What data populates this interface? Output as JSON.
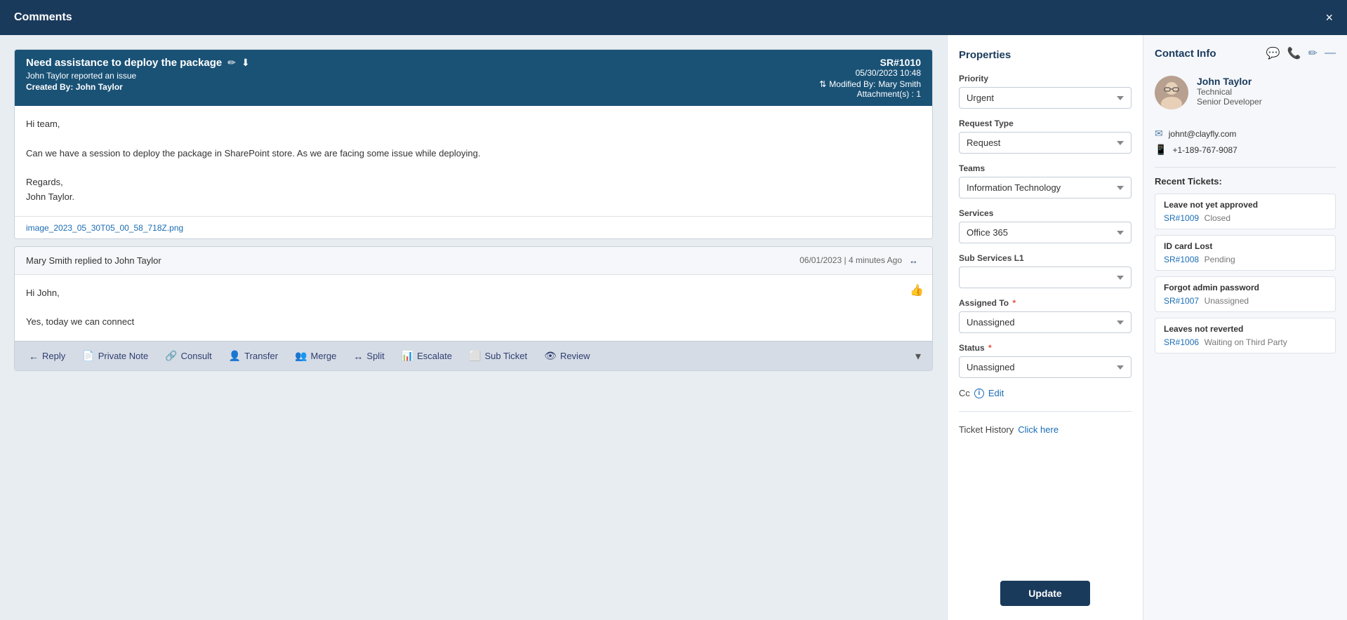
{
  "modal": {
    "title": "Comments",
    "close_label": "×"
  },
  "ticket": {
    "title": "Need assistance to deploy the package",
    "sr_number": "SR#1010",
    "reported": "John Taylor reported an issue",
    "created_by_label": "Created By:",
    "created_by": "John Taylor",
    "date": "05/30/2023 10:48",
    "modified_by_label": "Modified By:",
    "modified_by": "Mary Smith",
    "attachments_label": "Attachment(s) :",
    "attachments_count": "1",
    "body_line1": "Hi team,",
    "body_line2": "Can we have a session to deploy the package in SharePoint store. As we are facing some issue while deploying.",
    "body_line3": "Regards,",
    "body_line4": "John Taylor.",
    "attachment_link": "image_2023_05_30T05_00_58_718Z.png"
  },
  "reply": {
    "author": "Mary Smith replied to John Taylor",
    "date": "06/01/2023 | 4 minutes Ago",
    "expand_icon": "↔",
    "body_line1": "Hi John,",
    "body_line2": "Yes, today we can connect"
  },
  "actions": {
    "reply_label": "Reply",
    "private_note_label": "Private Note",
    "consult_label": "Consult",
    "transfer_label": "Transfer",
    "merge_label": "Merge",
    "split_label": "Split",
    "escalate_label": "Escalate",
    "sub_ticket_label": "Sub Ticket",
    "review_label": "Review"
  },
  "properties": {
    "title": "Properties",
    "priority_label": "Priority",
    "priority_value": "Urgent",
    "request_type_label": "Request Type",
    "request_type_value": "Request",
    "teams_label": "Teams",
    "teams_value": "Information Technology",
    "services_label": "Services",
    "services_value": "Office 365",
    "sub_services_label": "Sub Services L1",
    "sub_services_value": "",
    "assigned_to_label": "Assigned To",
    "assigned_to_value": "Unassigned",
    "status_label": "Status",
    "status_value": "Unassigned",
    "cc_label": "Cc",
    "cc_edit": "Edit",
    "ticket_history_label": "Ticket History",
    "ticket_history_link": "Click here",
    "update_btn": "Update"
  },
  "contact": {
    "title": "Contact Info",
    "name": "John Taylor",
    "role": "Technical",
    "job_title": "Senior Developer",
    "email": "johnt@clayfly.com",
    "phone": "+1-189-767-9087",
    "recent_tickets_title": "Recent Tickets:",
    "tickets": [
      {
        "title": "Leave not yet approved",
        "ref": "SR#1009",
        "status": "Closed"
      },
      {
        "title": "ID card Lost",
        "ref": "SR#1008",
        "status": "Pending"
      },
      {
        "title": "Forgot admin password",
        "ref": "SR#1007",
        "status": "Unassigned"
      },
      {
        "title": "Leaves not reverted",
        "ref": "SR#1006",
        "status": "Waiting on Third Party"
      }
    ]
  }
}
